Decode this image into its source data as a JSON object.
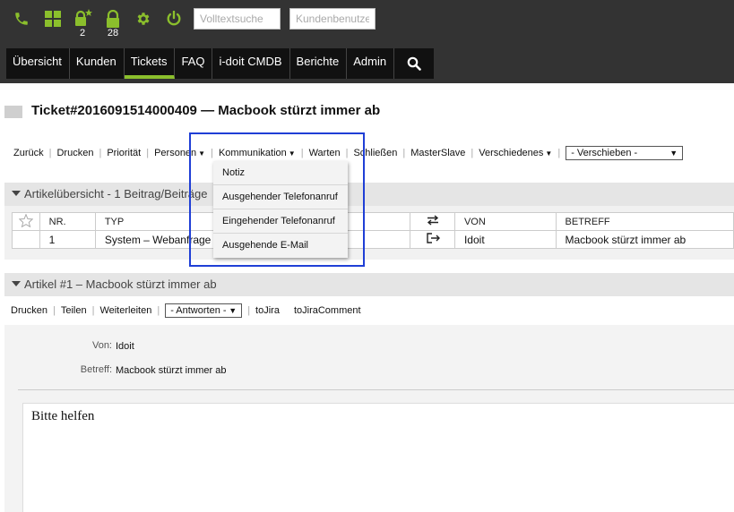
{
  "toolbar": {
    "phone_icon": "phone-icon",
    "dashboard_icon": "grid-icon",
    "lock_new_count": "2",
    "lock_count": "28",
    "settings_icon": "gear-icon",
    "power_icon": "power-icon",
    "fulltext_placeholder": "Volltextsuche",
    "customer_placeholder": "Kundenbenutze",
    "icon_color": "#8bbf2c"
  },
  "nav": {
    "items": [
      "Übersicht",
      "Kunden",
      "Tickets",
      "FAQ",
      "i-doit CMDB",
      "Berichte",
      "Admin"
    ],
    "active": "Tickets",
    "accent": "#8bbf2c"
  },
  "ticket": {
    "title": "Ticket#2016091514000409 — Macbook stürzt immer ab"
  },
  "actions": {
    "back": "Zurück",
    "print": "Drucken",
    "priority": "Priorität",
    "people": "Personen",
    "communication": "Kommunikation",
    "wait": "Warten",
    "close": "Schließen",
    "masterslave": "MasterSlave",
    "misc": "Verschiedenes",
    "move": "- Verschieben -"
  },
  "dropdown": {
    "items": [
      "Notiz",
      "Ausgehender Telefonanruf",
      "Eingehender Telefonanruf",
      "Ausgehende E-Mail"
    ],
    "highlight_color": "#1f3fd6"
  },
  "overview": {
    "header": "Artikelübersicht - 1 Beitrag/Beiträge",
    "columns": {
      "nr": "NR.",
      "type": "TYP",
      "from": "VON",
      "subject": "BETREFF"
    },
    "rows": [
      {
        "nr": "1",
        "type": "System – Webanfrage",
        "from": "Idoit",
        "subject": "Macbook stürzt immer ab"
      }
    ]
  },
  "article": {
    "header": "Artikel #1 – Macbook stürzt immer ab",
    "actions": {
      "print": "Drucken",
      "share": "Teilen",
      "forward": "Weiterleiten",
      "reply": "- Antworten -",
      "tojira": "toJira",
      "tojiracomment": "toJiraComment"
    },
    "from_label": "Von:",
    "from_value": "Idoit",
    "subject_label": "Betreff:",
    "subject_value": "Macbook stürzt immer ab",
    "body": "Bitte helfen"
  }
}
